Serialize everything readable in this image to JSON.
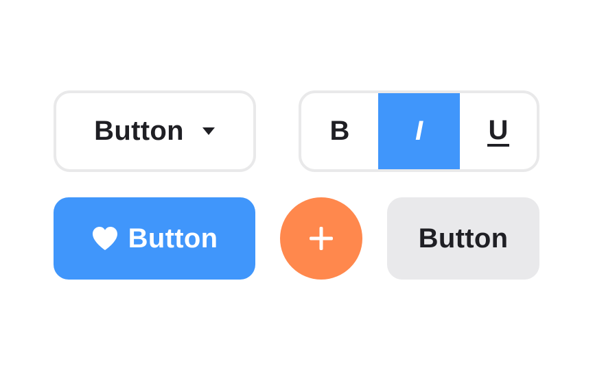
{
  "colors": {
    "accent_blue": "#4096fb",
    "accent_orange": "#ff884d",
    "neutral_gray": "#e9e9eb",
    "text_dark": "#1f1f24",
    "outline": "#e9e9ea"
  },
  "dropdown_button": {
    "label": "Button",
    "icon": "caret-down-icon"
  },
  "format_toggle": {
    "segments": [
      {
        "label": "B",
        "icon": "bold",
        "selected": false
      },
      {
        "label": "I",
        "icon": "italic",
        "selected": true
      },
      {
        "label": "U",
        "icon": "underline",
        "selected": false
      }
    ]
  },
  "primary_button": {
    "label": "Button",
    "icon": "heart-icon"
  },
  "add_button": {
    "icon": "plus-icon"
  },
  "secondary_button": {
    "label": "Button"
  }
}
